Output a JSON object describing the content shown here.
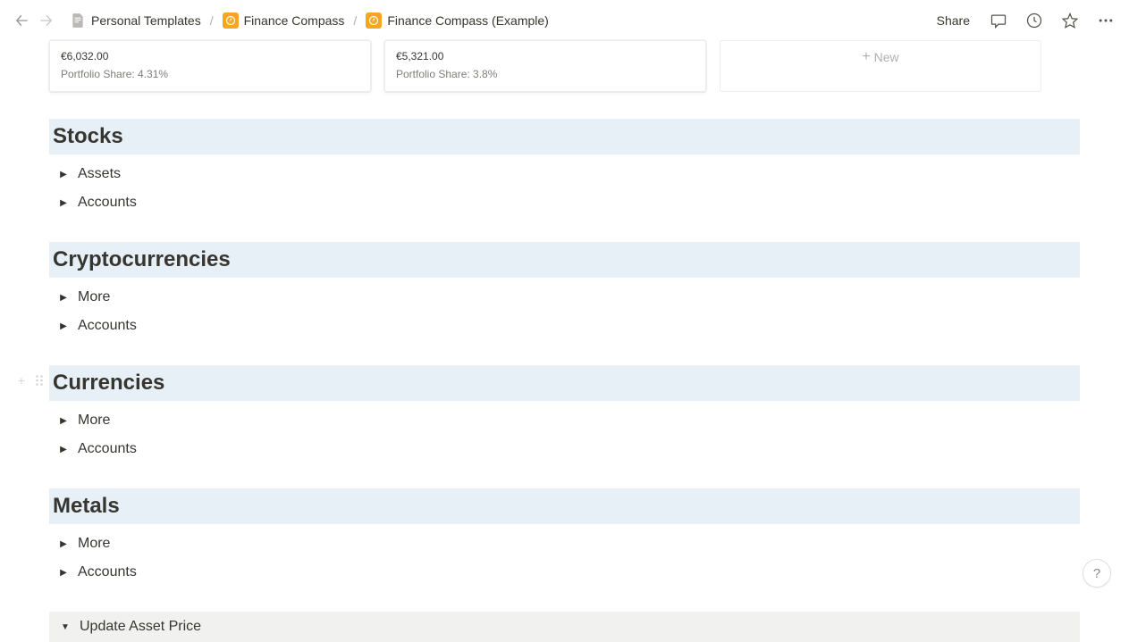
{
  "topbar": {
    "breadcrumb": [
      {
        "label": "Personal Templates",
        "icon": "document"
      },
      {
        "label": "Finance Compass",
        "icon": "orange-compass"
      },
      {
        "label": "Finance Compass (Example)",
        "icon": "orange-compass"
      }
    ],
    "share_label": "Share"
  },
  "cards": [
    {
      "value": "€6,032.00",
      "share_label": "Portfolio Share: 4.31%"
    },
    {
      "value": "€5,321.00",
      "share_label": "Portfolio Share: 3.8%"
    }
  ],
  "new_card_label": "New",
  "sections": [
    {
      "title": "Stocks",
      "toggles": [
        "Assets",
        "Accounts"
      ],
      "hovered": false
    },
    {
      "title": "Cryptocurrencies",
      "toggles": [
        "More",
        "Accounts"
      ],
      "hovered": false
    },
    {
      "title": "Currencies",
      "toggles": [
        "More",
        "Accounts"
      ],
      "hovered": true
    },
    {
      "title": "Metals",
      "toggles": [
        "More",
        "Accounts"
      ],
      "hovered": false
    }
  ],
  "update_bar_label": "Update Asset Price",
  "help_label": "?"
}
